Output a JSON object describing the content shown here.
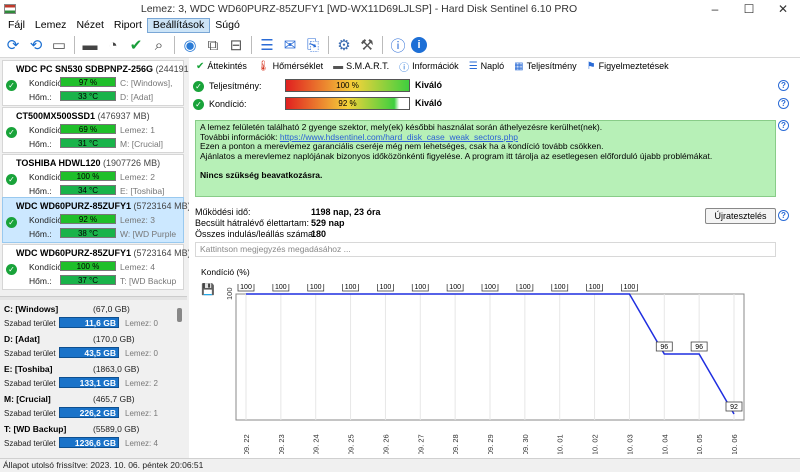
{
  "window": {
    "title": "Lemez: 3, WDC WD60PURZ-85ZUFY1 [WD-WX11D69LJLSP]  -  Hard Disk Sentinel 6.10 PRO"
  },
  "menu": [
    "Fájl",
    "Lemez",
    "Nézet",
    "Riport",
    "Beállítások",
    "Súgó"
  ],
  "disks": [
    {
      "name": "WDC PC SN530 SDBPNPZ-256G",
      "size": "(244191 MB)",
      "health_label": "Kondíció:",
      "health": "97 %",
      "health_value": 97,
      "temp_label": "Hőm.:",
      "temp": "33 °C",
      "drive1": "C: [Windows],",
      "drive2": "D: [Adat]"
    },
    {
      "name": "CT500MX500SSD1",
      "size": "(476937 MB)",
      "health_label": "Kondíció:",
      "health": "69 %",
      "health_value": 69,
      "temp_label": "Hőm.:",
      "temp": "31 °C",
      "drive1": "Lemez: 1",
      "drive2": "M: [Crucial]"
    },
    {
      "name": "TOSHIBA HDWL120",
      "size": "(1907726 MB)",
      "health_label": "Kondíció:",
      "health": "100 %",
      "health_value": 100,
      "temp_label": "Hőm.:",
      "temp": "34 °C",
      "drive1": "Lemez: 2",
      "drive2": "E: [Toshiba]"
    },
    {
      "name": "WDC WD60PURZ-85ZUFY1",
      "size": "(5723164 MB)",
      "health_label": "Kondíció:",
      "health": "92 %",
      "health_value": 92,
      "temp_label": "Hőm.:",
      "temp": "38 °C",
      "drive1": "Lemez: 3",
      "drive2": "W: [WD Purple"
    },
    {
      "name": "WDC WD60PURZ-85ZUFY1",
      "size": "(5723164 MB)",
      "health_label": "Kondíció:",
      "health": "100 %",
      "health_value": 100,
      "temp_label": "Hőm.:",
      "temp": "37 °C",
      "drive1": "Lemez: 4",
      "drive2": "T: [WD Backup"
    }
  ],
  "volumes": [
    {
      "name": "C: [Windows]",
      "size": "(67,0 GB)",
      "free_label": "Szabad terület",
      "free": "11,6 GB",
      "disk": "Lemez: 0"
    },
    {
      "name": "D: [Adat]",
      "size": "(170,0 GB)",
      "free_label": "Szabad terület",
      "free": "43,5 GB",
      "disk": "Lemez: 0"
    },
    {
      "name": "E: [Toshiba]",
      "size": "(1863,0 GB)",
      "free_label": "Szabad terület",
      "free": "133,1 GB",
      "disk": "Lemez: 2"
    },
    {
      "name": "M: [Crucial]",
      "size": "(465,7 GB)",
      "free_label": "Szabad terület",
      "free": "226,2 GB",
      "disk": "Lemez: 1"
    },
    {
      "name": "T: [WD Backup]",
      "size": "(5589,0 GB)",
      "free_label": "Szabad terület",
      "free": "1236,6 GB",
      "disk": "Lemez: 4"
    }
  ],
  "tabs": [
    "Áttekintés",
    "Hőmérséklet",
    "S.M.A.R.T.",
    "Információk",
    "Napló",
    "Teljesítmény",
    "Figyelmeztetések"
  ],
  "performance": {
    "label": "Teljesítmény:",
    "value": "100 %",
    "verdict": "Kiváló"
  },
  "health": {
    "label": "Kondíció:",
    "value": "92 %",
    "verdict": "Kiváló"
  },
  "info": {
    "line1": "A lemez felületén található 2 gyenge szektor, mely(ek) későbbi használat során áthelyezésre kerülhet(nek).",
    "line2_prefix": "További információk: ",
    "link": "https://www.hdsentinel.com/hard_disk_case_weak_sectors.php",
    "line3": "Ezen a ponton a merevlemez garanciális cseréje még nem lehetséges, csak ha a kondíció tovább csökken.",
    "line4": "Ajánlatos a merevlemez naplójának bizonyos időközönkénti figyelése. A program itt tárolja az esetlegesen előforduló újabb problémákat.",
    "conclusion": "Nincs szükség beavatkozásra."
  },
  "stats": {
    "uptime_label": "Működési idő:",
    "uptime": "1198 nap, 23 óra",
    "remaining_label": "Becsült hátralévő élettartam:",
    "remaining": "529 nap",
    "starts_label": "Összes indulás/leállás száma:",
    "starts": "180"
  },
  "retest_button": "Újratesztelés",
  "note_placeholder": "Kattintson megjegyzés megadásához ...",
  "chart_title": "Kondíció  (%)",
  "status": "Állapot utolsó frissítve: 2023. 10. 06. péntek 20:06:51",
  "chart_data": {
    "type": "line",
    "title": "Kondíció  (%)",
    "x": [
      "2023. 09. 22",
      "2023. 09. 23",
      "2023. 09. 24",
      "2023. 09. 25",
      "2023. 09. 26",
      "2023. 09. 27",
      "2023. 09. 28",
      "2023. 09. 29",
      "2023. 09. 30",
      "2023. 10. 01",
      "2023. 10. 02",
      "2023. 10. 03",
      "2023. 10. 04",
      "2023. 10. 05",
      "2023. 10. 06"
    ],
    "series": [
      {
        "values": [
          100,
          100,
          100,
          100,
          100,
          100,
          100,
          100,
          100,
          100,
          100,
          100,
          96,
          96,
          92
        ]
      }
    ],
    "y_axis_label": "100",
    "ylim": [
      92,
      100
    ],
    "line_color": "#1f2ee0"
  }
}
